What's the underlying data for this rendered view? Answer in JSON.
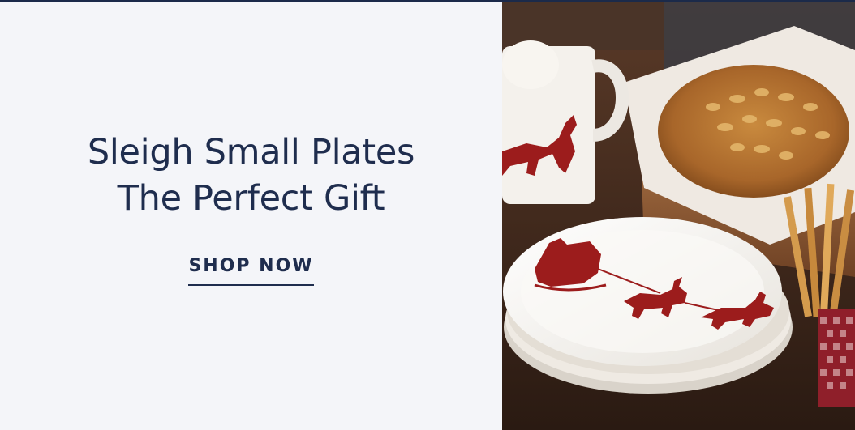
{
  "promo": {
    "headline_line1": "Sleigh Small Plates",
    "headline_line2": "The Perfect Gift",
    "cta_label": "SHOP NOW"
  },
  "colors": {
    "navy": "#1f2d4e",
    "panel": "#f4f5f9",
    "sleigh_red": "#9c1c1c"
  },
  "icons": {
    "reindeer": "reindeer-sleigh-icon"
  }
}
